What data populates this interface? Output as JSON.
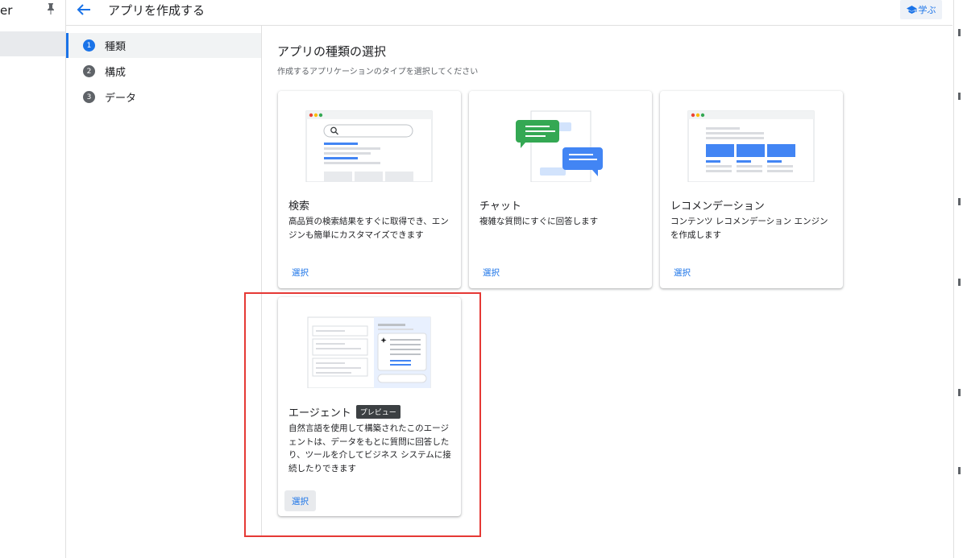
{
  "left_nav": {
    "title": "er",
    "pin_icon": "pin-icon"
  },
  "header": {
    "title": "アプリを作成する",
    "learn_label": "学ぶ"
  },
  "stepper": [
    {
      "num": "1",
      "label": "種類",
      "active": true
    },
    {
      "num": "2",
      "label": "構成",
      "active": false
    },
    {
      "num": "3",
      "label": "データ",
      "active": false
    }
  ],
  "main": {
    "title": "アプリの種類の選択",
    "subtitle": "作成するアプリケーションのタイプを選択してください"
  },
  "cards": [
    {
      "title": "検索",
      "desc": "高品質の検索結果をすぐに取得でき、エンジンも簡単にカスタマイズできます",
      "select": "選択"
    },
    {
      "title": "チャット",
      "desc": "複雑な質問にすぐに回答します",
      "select": "選択"
    },
    {
      "title": "レコメンデーション",
      "desc": "コンテンツ レコメンデーション エンジンを作成します",
      "select": "選択"
    },
    {
      "title": "エージェント",
      "badge": "プレビュー",
      "desc": "自然言語を使用して構築されたこのエージェントは、データをもとに質問に回答したり、ツールを介してビジネス システムに接続したりできます",
      "select": "選択"
    }
  ],
  "colors": {
    "accent": "#1a73e8",
    "highlight": "#e53935",
    "chat_green": "#34a853",
    "card_blue": "#4285f4"
  }
}
